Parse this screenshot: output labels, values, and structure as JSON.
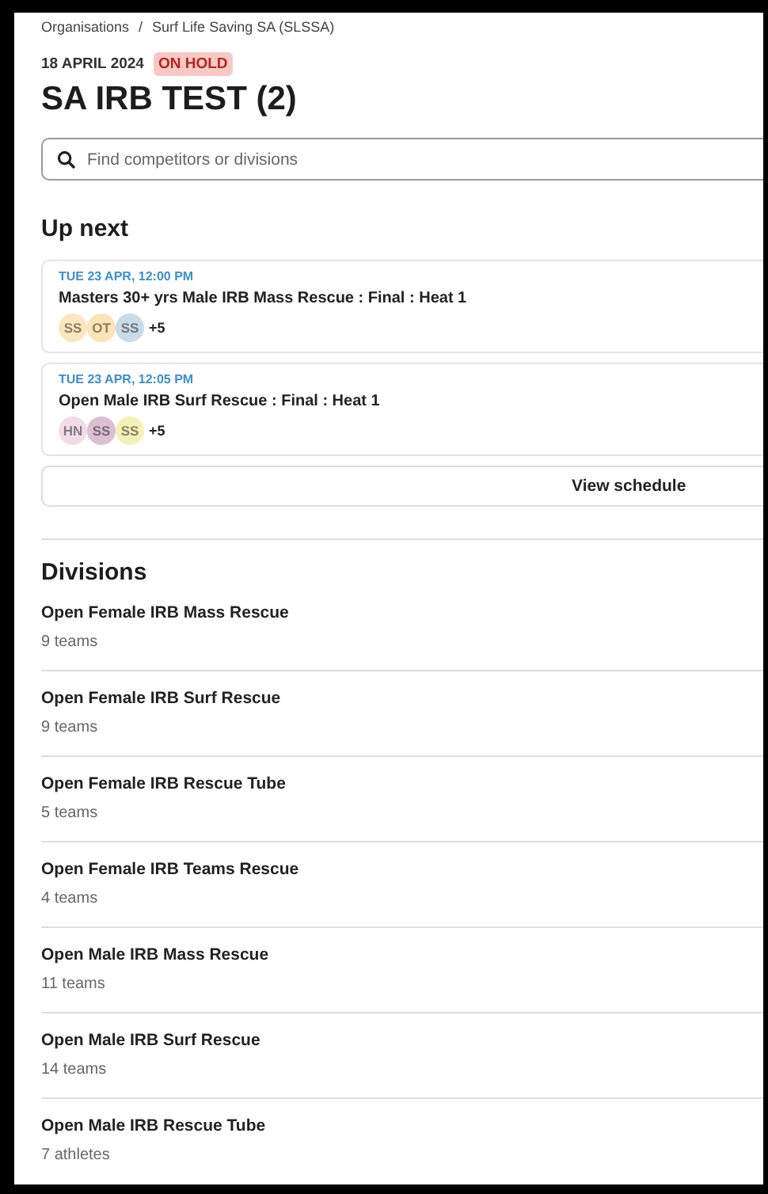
{
  "breadcrumb": [
    "Organisations",
    "Surf Life Saving SA (SLSSA)"
  ],
  "breadcrumb_separator": "/",
  "event": {
    "date": "18 APRIL 2024",
    "status": "ON HOLD",
    "title": "SA IRB TEST (2)"
  },
  "search": {
    "placeholder": "Find competitors or divisions"
  },
  "up_next": {
    "heading": "Up next",
    "items": [
      {
        "time": "TUE 23 APR, 12:00 PM",
        "title": "Masters 30+ yrs Male IRB Mass Rescue : Final : Heat 1",
        "avatars": [
          {
            "initials": "SS",
            "color": "#fbe7bd"
          },
          {
            "initials": "OT",
            "color": "#fde3b6"
          },
          {
            "initials": "SS",
            "color": "#c9dbe8"
          }
        ],
        "more": "+5"
      },
      {
        "time": "TUE 23 APR, 12:05 PM",
        "title": "Open Male IRB Surf Rescue : Final : Heat 1",
        "avatars": [
          {
            "initials": "HN",
            "color": "#f3dcea"
          },
          {
            "initials": "SS",
            "color": "#dcbfd3"
          },
          {
            "initials": "SS",
            "color": "#f4f1b8"
          }
        ],
        "more": "+5"
      }
    ],
    "button": "View schedule"
  },
  "divisions": {
    "heading": "Divisions",
    "items": [
      {
        "name": "Open Female IRB Mass Rescue",
        "count": "9 teams"
      },
      {
        "name": "Open Female IRB Surf Rescue",
        "count": "9 teams"
      },
      {
        "name": "Open Female IRB Rescue Tube",
        "count": "5 teams"
      },
      {
        "name": "Open Female IRB Teams Rescue",
        "count": "4 teams"
      },
      {
        "name": "Open Male IRB Mass Rescue",
        "count": "11 teams"
      },
      {
        "name": "Open Male IRB Surf Rescue",
        "count": "14 teams"
      },
      {
        "name": "Open Male IRB Rescue Tube",
        "count": "7 athletes"
      }
    ]
  }
}
